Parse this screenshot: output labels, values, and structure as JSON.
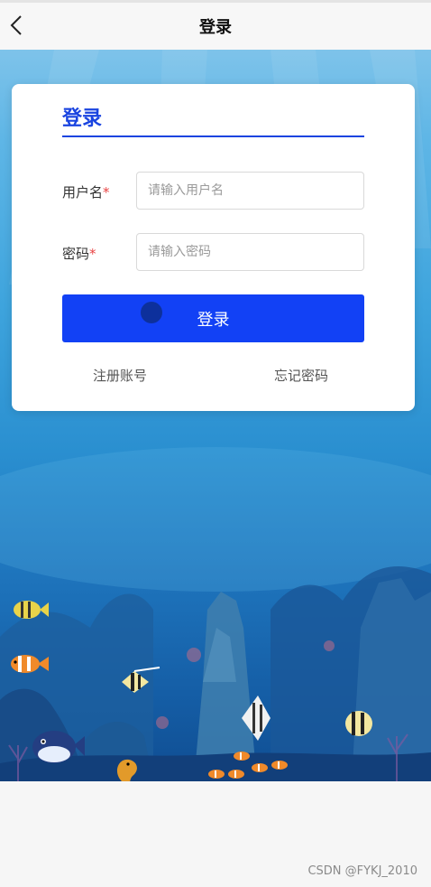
{
  "nav": {
    "title": "登录",
    "back_icon": "chevron-left-icon"
  },
  "card": {
    "title": "登录",
    "username": {
      "label": "用户名",
      "required_mark": "*",
      "placeholder": "请输入用户名",
      "value": ""
    },
    "password": {
      "label": "密码",
      "required_mark": "*",
      "placeholder": "请输入密码",
      "value": ""
    },
    "login_button": "登录",
    "register_link": "注册账号",
    "forgot_link": "忘记密码"
  },
  "watermark": "CSDN @FYKJ_2010",
  "colors": {
    "accent": "#1a44e0",
    "button": "#1241f5",
    "required": "#e84343"
  }
}
